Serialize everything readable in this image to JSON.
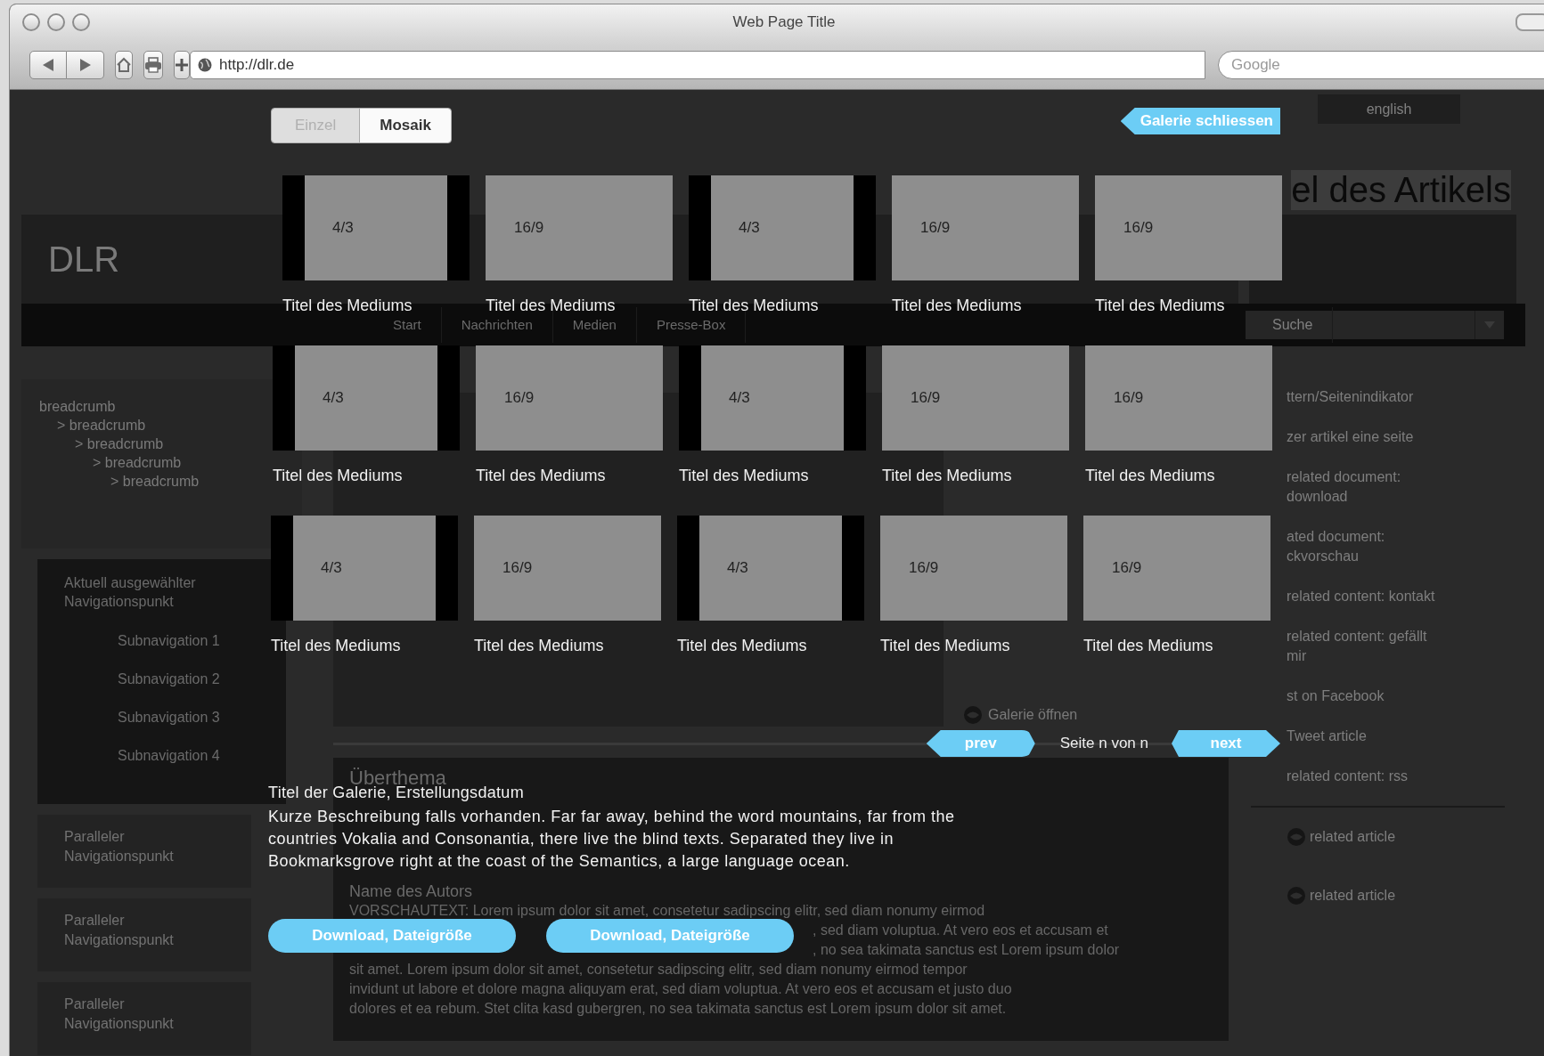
{
  "browser": {
    "title": "Web Page Title",
    "url": "http://dlr.de",
    "search": {
      "placeholder": "Google"
    }
  },
  "page": {
    "language_tab": "english",
    "article_title": "el des Artikels",
    "logo": "DLR",
    "nav_items": [
      "Start",
      "Nachrichten",
      "Medien",
      "Presse-Box"
    ],
    "search_dropdown": {
      "placeholder": "Suche"
    },
    "breadcrumbs": [
      {
        "label": "breadcrumb",
        "children": [
          {
            "label": "> breadcrumb",
            "children": [
              {
                "label": "> breadcrumb",
                "children": [
                  {
                    "label": "> breadcrumb",
                    "children": [
                      {
                        "label": "> breadcrumb"
                      }
                    ]
                  }
                ]
              }
            ]
          }
        ]
      }
    ],
    "active_nav": {
      "label": "Aktuell ausgewählter Navigationspunkt",
      "subnav": [
        "Subnavigation 1",
        "Subnavigation 2",
        "Subnavigation 3",
        "Subnavigation 4"
      ]
    },
    "parallel_nav": [
      "Paralleler Navigationspunkt",
      "Paralleler Navigationspunkt",
      "Paralleler Navigationspunkt"
    ],
    "gallery_link": "Galerie öffnen",
    "article": {
      "topic": "Überthema",
      "author": "Name des Autors",
      "preview_lines": [
        {
          "kind": "full",
          "text": "VORSCHAUTEXT: Lorem ipsum dolor sit amet, consetetur sadipscing elitr, sed diam nonumy eirmod"
        },
        {
          "kind": "partial",
          "text": ", sed diam voluptua. At vero eos et accusam et"
        },
        {
          "kind": "partial",
          "text": ", no sea takimata sanctus est Lorem ipsum dolor"
        },
        {
          "kind": "full",
          "text": "sit amet. Lorem ipsum dolor sit amet, consetetur sadipscing elitr, sed diam nonumy eirmod tempor"
        },
        {
          "kind": "full",
          "text": "invidunt ut labore et dolore magna aliquyam erat, sed diam voluptua. At vero eos et accusam et justo duo"
        },
        {
          "kind": "full",
          "text": "dolores et ea rebum. Stet clita kasd gubergren, no sea takimata sanctus est Lorem ipsum dolor sit amet."
        }
      ]
    },
    "sidebar_links": [
      {
        "kind": "text",
        "lines": [
          "ttern/Seitenindikator"
        ]
      },
      {
        "kind": "text",
        "lines": [
          "zer artikel eine seite"
        ]
      },
      {
        "kind": "text",
        "lines": [
          "related document:",
          "download"
        ]
      },
      {
        "kind": "text",
        "lines": [
          "ated document:",
          "ckvorschau"
        ]
      },
      {
        "kind": "text",
        "lines": [
          "related content: kontakt"
        ]
      },
      {
        "kind": "text",
        "lines": [
          "related content: gefällt",
          "mir"
        ]
      },
      {
        "kind": "text",
        "lines": [
          "st on Facebook"
        ]
      },
      {
        "kind": "text",
        "lines": [
          "Tweet article"
        ]
      },
      {
        "kind": "text",
        "lines": [
          "related content: rss"
        ]
      },
      {
        "kind": "article",
        "lines": [
          "related article"
        ]
      },
      {
        "kind": "article",
        "lines": [
          "related article"
        ]
      }
    ]
  },
  "gallery": {
    "view_tabs": [
      {
        "label": "Einzel",
        "selected": false
      },
      {
        "label": "Mosaik",
        "selected": true
      }
    ],
    "close": "Galerie schliessen",
    "rows": [
      {
        "tiles": [
          {
            "ratio": "4/3",
            "kind": "narrow",
            "title": "Titel des Mediums"
          },
          {
            "ratio": "16/9",
            "kind": "wide",
            "title": "Titel des Mediums"
          },
          {
            "ratio": "4/3",
            "kind": "narrow",
            "title": "Titel des Mediums"
          },
          {
            "ratio": "16/9",
            "kind": "wide",
            "title": "Titel des Mediums"
          },
          {
            "ratio": "16/9",
            "kind": "wide",
            "title": "Titel des Mediums"
          }
        ]
      },
      {
        "tiles": [
          {
            "ratio": "4/3",
            "kind": "narrow",
            "title": "Titel des Mediums"
          },
          {
            "ratio": "16/9",
            "kind": "wide",
            "title": "Titel des Mediums"
          },
          {
            "ratio": "4/3",
            "kind": "narrow",
            "title": "Titel des Mediums"
          },
          {
            "ratio": "16/9",
            "kind": "wide",
            "title": "Titel des Mediums"
          },
          {
            "ratio": "16/9",
            "kind": "wide",
            "title": "Titel des Mediums"
          }
        ]
      },
      {
        "tiles": [
          {
            "ratio": "4/3",
            "kind": "narrow",
            "title": "Titel des Mediums"
          },
          {
            "ratio": "16/9",
            "kind": "wide",
            "title": "Titel des Mediums"
          },
          {
            "ratio": "4/3",
            "kind": "narrow",
            "title": "Titel des Mediums"
          },
          {
            "ratio": "16/9",
            "kind": "wide",
            "title": "Titel des Mediums"
          },
          {
            "ratio": "16/9",
            "kind": "wide",
            "title": "Titel des Mediums"
          }
        ]
      }
    ],
    "pager": {
      "prev": "prev",
      "status": "Seite n von n",
      "next": "next"
    },
    "caption": "Titel der Galerie, Erstellungsdatum",
    "description": "Kurze Beschreibung falls vorhanden. Far far away, behind the word mountains, far from the countries Vokalia and Consonantia, there live the blind texts. Separated they live in Bookmarksgrove right at the coast of the Semantics, a large language ocean.",
    "downloads": [
      "Download, Dateigröße",
      "Download, Dateigröße"
    ]
  }
}
